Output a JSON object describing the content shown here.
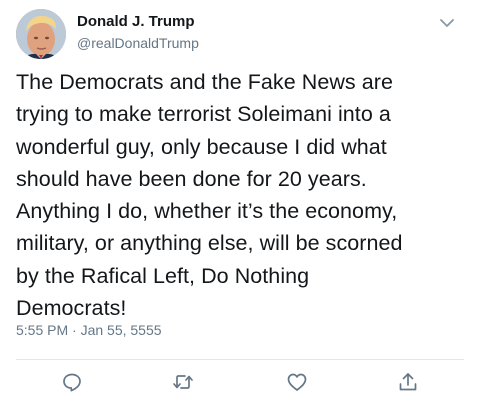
{
  "tweet": {
    "author_name": "Donald J. Trump",
    "author_handle": "@realDonaldTrump",
    "text": "The Democrats and the Fake News are\ntrying to make terrorist Soleimani into a\nwonderful guy, only because I did what\nshould have been done for 20 years.\nAnything I do, whether it’s the economy,\nmilitary, or anything else, will be scorned\nby the Rafical Left, Do Nothing\nDemocrats!",
    "timestamp": "5:55 PM · Jan 55, 5555"
  },
  "icons": {
    "menu": "chevron-down-icon",
    "reply": "reply-icon",
    "retweet": "retweet-icon",
    "like": "heart-icon",
    "share": "share-icon"
  },
  "colors": {
    "text": "#14171a",
    "secondary": "#657786",
    "divider": "#e1e8ed"
  }
}
